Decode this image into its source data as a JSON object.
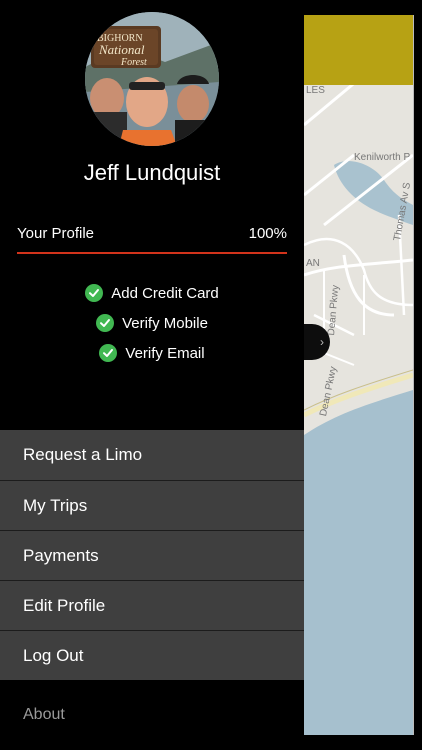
{
  "user": {
    "name": "Jeff Lundquist",
    "avatar_sign_text": [
      "BIGHORN",
      "National",
      "Forest"
    ]
  },
  "profile": {
    "label": "Your Profile",
    "percent_text": "100%",
    "completion": 1.0
  },
  "checklist": [
    {
      "label": "Add Credit Card",
      "done": true
    },
    {
      "label": "Verify Mobile",
      "done": true
    },
    {
      "label": "Verify Email",
      "done": true
    }
  ],
  "menu": [
    {
      "label": "Request a Limo"
    },
    {
      "label": "My Trips"
    },
    {
      "label": "Payments"
    },
    {
      "label": "Edit Profile"
    },
    {
      "label": "Log Out"
    }
  ],
  "footer": {
    "about_label": "About"
  },
  "map": {
    "labels": [
      "Kenilworth P",
      "Thomas Av S",
      "Dean Pkwy",
      "Dean Pkwy",
      "AN",
      "LES"
    ],
    "button_glyph": "›"
  },
  "colors": {
    "accent_red": "#d2331b",
    "check_green": "#41b852",
    "menu_bg": "#3f3f3f",
    "map_top_bar": "#b7a214"
  }
}
